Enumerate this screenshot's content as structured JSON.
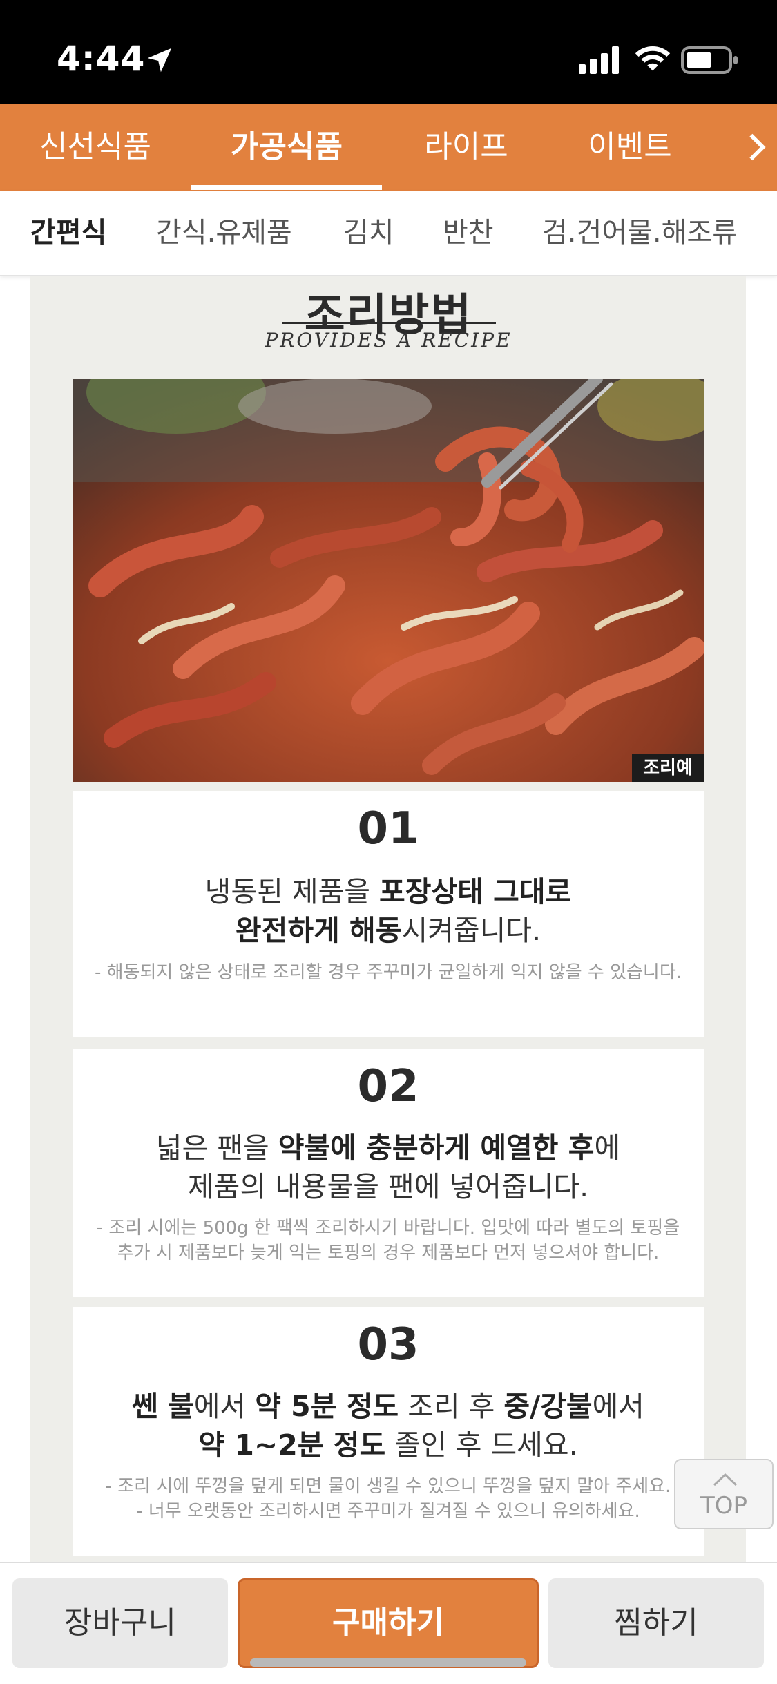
{
  "status_bar": {
    "time": "4:44"
  },
  "main_nav": {
    "tabs": [
      {
        "label": "신선식품",
        "active": false
      },
      {
        "label": "가공식품",
        "active": true
      },
      {
        "label": "라이프",
        "active": false
      },
      {
        "label": "이벤트",
        "active": false
      }
    ],
    "more_icon": "chevron-right-icon"
  },
  "sub_nav": {
    "tabs": [
      {
        "label": "간편식",
        "active": true
      },
      {
        "label": "간식.유제품",
        "active": false
      },
      {
        "label": "김치",
        "active": false
      },
      {
        "label": "반찬",
        "active": false
      },
      {
        "label": "검.건어물.해조류",
        "active": false
      }
    ]
  },
  "recipe": {
    "title": "조리방법",
    "subtitle": "PROVIDES A RECIPE",
    "image_caption": "조리예",
    "steps": [
      {
        "number": "01",
        "main": [
          {
            "text": "냉동된 제품을 ",
            "bold": false
          },
          {
            "text": "포장상태 그대로",
            "bold": true
          },
          {
            "text": "완전하게 해동",
            "bold": true,
            "newline": true
          },
          {
            "text": "시켜줍니다.",
            "bold": false
          }
        ],
        "notes": [
          "- 해동되지 않은 상태로 조리할 경우 주꾸미가 균일하게 익지 않을 수 있습니다."
        ]
      },
      {
        "number": "02",
        "main": [
          {
            "text": "넓은 팬을 ",
            "bold": false
          },
          {
            "text": "약불에 충분하게 예열한 후",
            "bold": true
          },
          {
            "text": "에",
            "bold": false
          },
          {
            "text": "제품의 내용물을 팬에 넣어줍니다.",
            "bold": false,
            "newline": true
          }
        ],
        "notes": [
          "- 조리 시에는 500g 한 팩씩 조리하시기 바랍니다. 입맛에 따라 별도의 토핑을",
          "추가 시 제품보다 늦게 익는 토핑의 경우 제품보다 먼저 넣으셔야 합니다."
        ]
      },
      {
        "number": "03",
        "main": [
          {
            "text": "쎈 불",
            "bold": true
          },
          {
            "text": "에서 ",
            "bold": false
          },
          {
            "text": "약 5분 정도",
            "bold": true
          },
          {
            "text": " 조리 후 ",
            "bold": false
          },
          {
            "text": "중/강불",
            "bold": true
          },
          {
            "text": "에서",
            "bold": false
          },
          {
            "text": "약 1~2분 정도",
            "bold": true,
            "newline": true
          },
          {
            "text": " 졸인 후 드세요.",
            "bold": false
          }
        ],
        "notes": [
          "- 조리 시에 뚜껑을 덮게 되면 물이 생길 수 있으니 뚜껑을 덮지 말아 주세요.",
          "- 너무 오랫동안 조리하시면 주꾸미가 질겨질 수 있으니 유의하세요."
        ]
      }
    ]
  },
  "top_button": {
    "label": "TOP"
  },
  "bottom_bar": {
    "cart_label": "장바구니",
    "buy_label": "구매하기",
    "wish_label": "찜하기"
  },
  "colors": {
    "brand": "#e2813e",
    "panel": "#eeeeea"
  }
}
